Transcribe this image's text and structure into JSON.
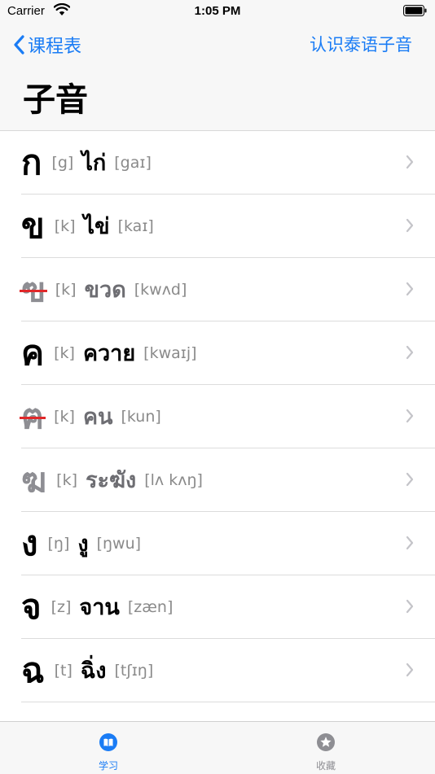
{
  "status": {
    "carrier": "Carrier",
    "time": "1:05 PM"
  },
  "nav": {
    "back_label": "课程表",
    "right_action": "认识泰语子音",
    "title": "子音"
  },
  "rows": [
    {
      "consonant": "ก",
      "ipa": "[g]",
      "word": "ไก่",
      "word_ipa": "[gaɪ]",
      "style": "normal"
    },
    {
      "consonant": "ข",
      "ipa": "[k]",
      "word": "ไข่",
      "word_ipa": "[kaɪ]",
      "style": "normal"
    },
    {
      "consonant": "ฃ",
      "ipa": "[k]",
      "word": "ขวด",
      "word_ipa": "[kwʌd]",
      "style": "obsolete"
    },
    {
      "consonant": "ค",
      "ipa": "[k]",
      "word": "ควาย",
      "word_ipa": "[kwaɪj]",
      "style": "normal"
    },
    {
      "consonant": "ฅ",
      "ipa": "[k]",
      "word": "คน",
      "word_ipa": "[kun]",
      "style": "obsolete"
    },
    {
      "consonant": "ฆ",
      "ipa": "[k]",
      "word": "ระฆัง",
      "word_ipa": "[lʌ kʌŋ]",
      "style": "dim"
    },
    {
      "consonant": "ง",
      "ipa": "[ŋ]",
      "word": "งู",
      "word_ipa": "[ŋwu]",
      "style": "normal"
    },
    {
      "consonant": "จ",
      "ipa": "[z]",
      "word": "จาน",
      "word_ipa": "[zæn]",
      "style": "normal"
    },
    {
      "consonant": "ฉ",
      "ipa": "[t]",
      "word": "ฉิ่ง",
      "word_ipa": "[tʃɪŋ]",
      "style": "normal"
    }
  ],
  "tabs": [
    {
      "label": "学习",
      "icon": "book-icon",
      "active": true
    },
    {
      "label": "收藏",
      "icon": "star-icon",
      "active": false
    }
  ],
  "colors": {
    "accent": "#1a7cf5",
    "strike": "#e0282a",
    "secondary": "#8a8a8a"
  }
}
